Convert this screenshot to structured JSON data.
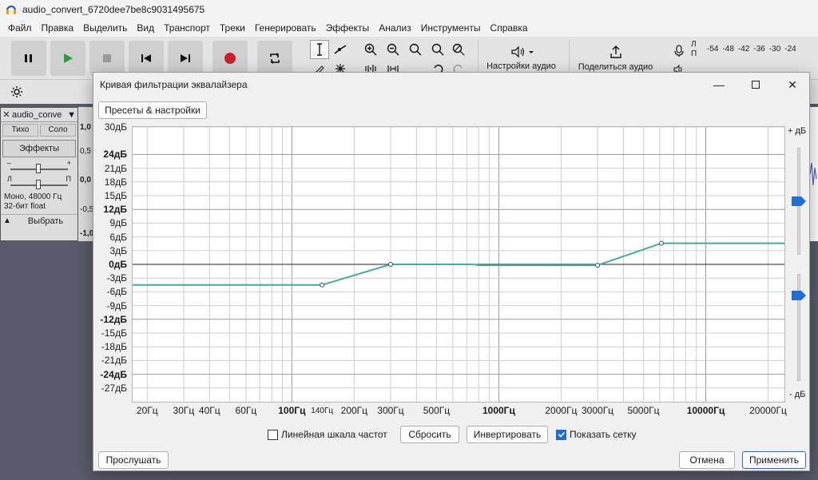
{
  "window": {
    "title": "audio_convert_6720dee7be8c9031495675"
  },
  "menu": [
    "Файл",
    "Правка",
    "Выделить",
    "Вид",
    "Транспорт",
    "Треки",
    "Генерировать",
    "Эффекты",
    "Анализ",
    "Инструменты",
    "Справка"
  ],
  "toolbar": {
    "audio_setup_label": "Настройки аудио",
    "share_audio_label": "Поделиться аудио",
    "meter_ticks": [
      "-54",
      "-48",
      "-42",
      "-36",
      "-30",
      "-24"
    ],
    "meter_rec_label": "Л",
    "meter_play_label": "П"
  },
  "track": {
    "name": "audio_conve",
    "mute": "Тихо",
    "solo": "Соло",
    "effects": "Эффекты",
    "gain_min": "–",
    "gain_max": "+",
    "pan_left": "Л",
    "pan_right": "П",
    "info_line1": "Моно, 48000 Гц",
    "info_line2": "32-бит float",
    "select": "Выбрать",
    "scale": [
      "1,0",
      "0,5",
      "0,0",
      "-0,5",
      "-1,0"
    ]
  },
  "dialog": {
    "title": "Кривая фильтрации эквалайзера",
    "presets_button": "Пресеты & настройки",
    "db_max_label": "+ дБ",
    "db_min_label": "- дБ",
    "y_ticks": [
      {
        "label": "30дБ",
        "value": 30,
        "bold": false
      },
      {
        "label": "24дБ",
        "value": 24,
        "bold": true
      },
      {
        "label": "21дБ",
        "value": 21,
        "bold": false
      },
      {
        "label": "18дБ",
        "value": 18,
        "bold": false
      },
      {
        "label": "15дБ",
        "value": 15,
        "bold": false
      },
      {
        "label": "12дБ",
        "value": 12,
        "bold": true
      },
      {
        "label": "9дБ",
        "value": 9,
        "bold": false
      },
      {
        "label": "6дБ",
        "value": 6,
        "bold": false
      },
      {
        "label": "3дБ",
        "value": 3,
        "bold": false
      },
      {
        "label": "0дБ",
        "value": 0,
        "bold": true
      },
      {
        "label": "-3дБ",
        "value": -3,
        "bold": false
      },
      {
        "label": "-6дБ",
        "value": -6,
        "bold": false
      },
      {
        "label": "-9дБ",
        "value": -9,
        "bold": false
      },
      {
        "label": "-12дБ",
        "value": -12,
        "bold": true
      },
      {
        "label": "-15дБ",
        "value": -15,
        "bold": false
      },
      {
        "label": "-18дБ",
        "value": -18,
        "bold": false
      },
      {
        "label": "-21дБ",
        "value": -21,
        "bold": false
      },
      {
        "label": "-24дБ",
        "value": -24,
        "bold": true
      },
      {
        "label": "-27дБ",
        "value": -27,
        "bold": false
      }
    ],
    "x_ticks": [
      {
        "label": "20Гц",
        "value": 20,
        "style": "normal"
      },
      {
        "label": "30Гц",
        "value": 30,
        "style": "normal"
      },
      {
        "label": "40Гц",
        "value": 40,
        "style": "normal"
      },
      {
        "label": "60Гц",
        "value": 60,
        "style": "normal"
      },
      {
        "label": "100Гц",
        "value": 100,
        "style": "bold"
      },
      {
        "label": "140Гц",
        "value": 140,
        "style": "small"
      },
      {
        "label": "200Гц",
        "value": 200,
        "style": "normal"
      },
      {
        "label": "300Гц",
        "value": 300,
        "style": "normal"
      },
      {
        "label": "500Гц",
        "value": 500,
        "style": "normal"
      },
      {
        "label": "1000Гц",
        "value": 1000,
        "style": "bold"
      },
      {
        "label": "2000Гц",
        "value": 2000,
        "style": "normal"
      },
      {
        "label": "3000Гц",
        "value": 3000,
        "style": "normal"
      },
      {
        "label": "5000Гц",
        "value": 5000,
        "style": "normal"
      },
      {
        "label": "10000Гц",
        "value": 10000,
        "style": "bold"
      },
      {
        "label": "20000Гц",
        "value": 20000,
        "style": "normal"
      }
    ],
    "linear_scale_label": "Линейная шкала частот",
    "linear_scale_checked": false,
    "reset_button": "Сбросить",
    "invert_button": "Инвертировать",
    "show_grid_label": "Показать сетку",
    "show_grid_checked": true,
    "preview_button": "Прослушать",
    "cancel_button": "Отмена",
    "apply_button": "Применить"
  },
  "chart_data": {
    "type": "line",
    "x_scale": "log",
    "xlim": [
      17,
      24000
    ],
    "ylim": [
      -30,
      30
    ],
    "xlabel": "",
    "ylabel": "",
    "grid": true,
    "curve_color": "#4aa89a",
    "curve_points": [
      {
        "x": 17,
        "y": -4.5
      },
      {
        "x": 140,
        "y": -4.5
      },
      {
        "x": 300,
        "y": 0
      },
      {
        "x": 750,
        "y": 0
      },
      {
        "x": 800,
        "y": -0.2
      },
      {
        "x": 2500,
        "y": -0.2
      },
      {
        "x": 3000,
        "y": -0.2
      },
      {
        "x": 6100,
        "y": 4.6
      },
      {
        "x": 24000,
        "y": 4.6
      }
    ],
    "control_points": [
      {
        "x": 140,
        "y": -4.5
      },
      {
        "x": 300,
        "y": 0
      },
      {
        "x": 3000,
        "y": -0.2
      },
      {
        "x": 6100,
        "y": 4.6
      }
    ]
  },
  "colors": {
    "accent": "#1f6fd1",
    "record": "#c8202c",
    "play": "#2e9a3e",
    "curve": "#4aa89a"
  }
}
